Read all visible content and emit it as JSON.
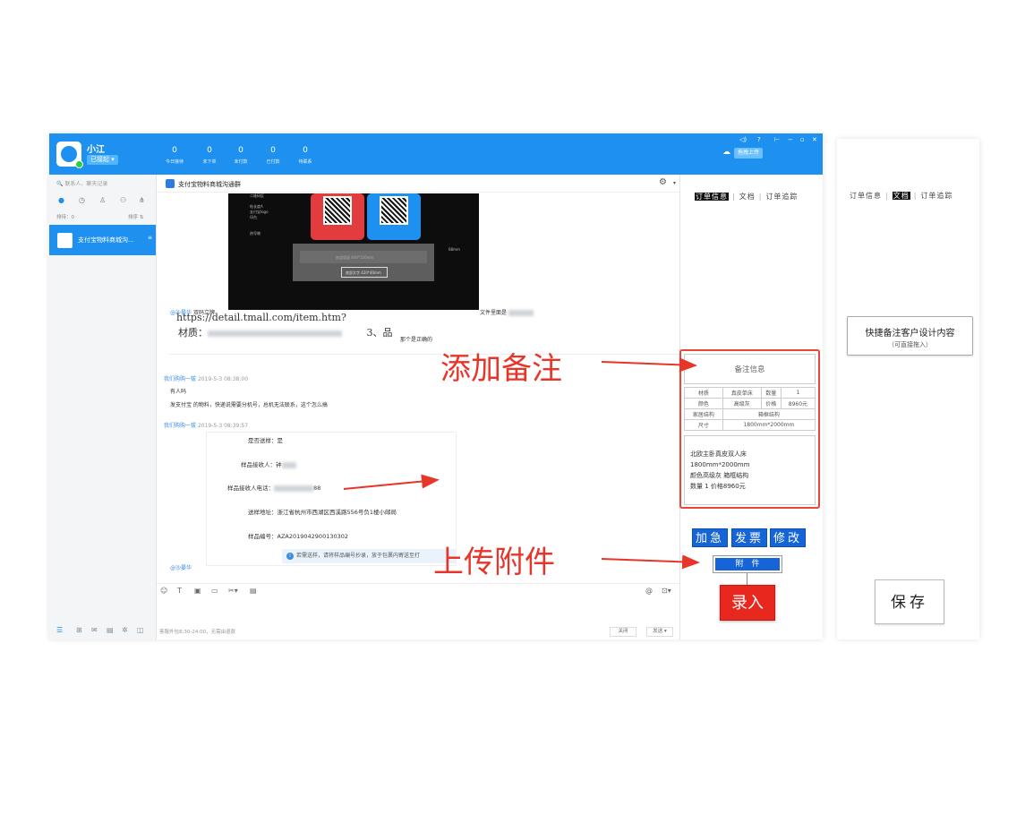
{
  "topbar": {
    "username": "小江",
    "status": "已接起 ▾",
    "stats": [
      {
        "value": "0",
        "label": "今日接待"
      },
      {
        "value": "0",
        "label": "未下单"
      },
      {
        "value": "0",
        "label": "未付款"
      },
      {
        "value": "0",
        "label": "已付款"
      },
      {
        "value": "0",
        "label": "待联系"
      }
    ],
    "upload_label": "拖拽上传",
    "window_controls": [
      "◁)",
      "?",
      "⊢",
      "−",
      "▫",
      "✕"
    ]
  },
  "left_panel": {
    "search_placeholder": "联系人、聊天记录",
    "sort_left": "排待：0",
    "sort_right": "排序 ⇅",
    "conversation_title": "支付宝物料商城沟...",
    "conversation_mark": "≡"
  },
  "chat": {
    "group_name": "支付宝物料商城沟通群",
    "msg1_sender": "@沙晏华",
    "msg1_text": "双码立牌",
    "msg1_suffix": "文件里面是",
    "link_text": "https://detail.tmall.com/item.htm?id=581211595011",
    "material_text": "材质：",
    "material_suffix": "3、品",
    "correct_text": "那个是正确的",
    "msg2_sender": "我们购购一拔",
    "msg2_time": "2019-5-3 08:38:00",
    "msg2_line1": "有人吗",
    "msg2_line2": "发支付宝 的物料，快递说需要分机号，总机无法联系，这个怎么搞",
    "msg3_sender": "我们购购一拔",
    "msg3_time": "2019-5-3 08:39:57",
    "card": {
      "sample_send": "是否送样：是",
      "receiver": "样品接收人：钟",
      "phone_label": "样品接收人电话：",
      "phone_suffix": "88",
      "address": "送样地址：浙江省杭州市西湖区西溪路556号负1楼小邮局",
      "sample_no": "样品编号：AZA2019042900130302"
    },
    "notice": "若需送样，请将样品编号抄录，放于包裹内寄送至打",
    "msg4_sender": "@沙晏华",
    "footer": "客服外包8:30-24:00，无需由退款",
    "close_label": "关闭",
    "send_label": "发送 ▾"
  },
  "right_panel": {
    "tabs": [
      "订单信息",
      "文档",
      "订单追踪"
    ],
    "note_title": "备注信息",
    "table": [
      [
        "材质",
        "真皮单床",
        "数量",
        "1"
      ],
      [
        "颜色",
        "高级灰",
        "价格",
        "8960元"
      ],
      [
        "家居结构",
        "箱框结构"
      ],
      [
        "尺寸",
        "1800mm*2000mm"
      ]
    ],
    "note_lines": [
      "北欧主卧真皮双人床",
      "1800mm*2000mm",
      "颜色高级灰  箱框结构",
      "数量 1  价格8960元"
    ],
    "buttons": [
      "加急",
      "发票",
      "修改"
    ],
    "attach_label": "附　件",
    "entry_label": "录入"
  },
  "extra_panel": {
    "tabs": [
      "订单信息",
      "文档",
      "订单追踪"
    ],
    "quick_title": "快捷备注客户设计内容",
    "quick_sub": "（可直接拖入）",
    "save_label": "保存"
  },
  "annotations": {
    "add_note": "添加备注",
    "upload_attach": "上传附件"
  },
  "image_labels": {
    "l1": "二维码区",
    "l2": "帖长度A",
    "l3": "支付宝logo",
    "l4": "印台",
    "l5": "热号墩",
    "bar": "底部版面  840*150mm",
    "btn": "底部文字  420*40mm",
    "height": "68mm"
  },
  "colors": {
    "accent": "#1e90f0",
    "annotation": "#e8352a",
    "entry": "#e8281e"
  }
}
